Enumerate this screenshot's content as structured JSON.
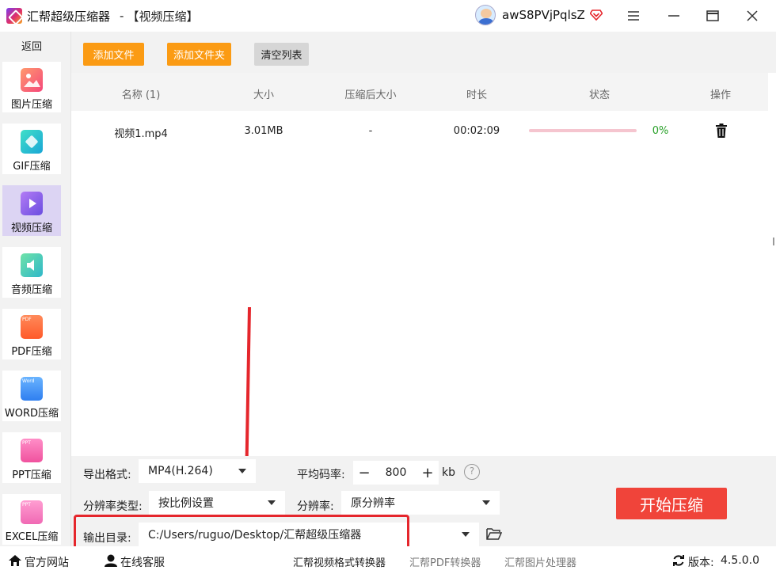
{
  "window": {
    "app_title": "汇帮超级压缩器",
    "separator": "-",
    "module_title": "【视频压缩】",
    "username": "awS8PVjPqlsZ",
    "brand_color": "#fb9b14",
    "accent_color": "#f0443a"
  },
  "sidebar": {
    "back_label": "返回",
    "items": [
      {
        "label": "图片压缩",
        "icon": "image-icon",
        "active": false
      },
      {
        "label": "GIF压缩",
        "icon": "gif-icon",
        "active": false
      },
      {
        "label": "视频压缩",
        "icon": "video-icon",
        "active": true
      },
      {
        "label": "音频压缩",
        "icon": "audio-icon",
        "active": false
      },
      {
        "label": "PDF压缩",
        "icon": "pdf-icon",
        "active": false
      },
      {
        "label": "WORD压缩",
        "icon": "word-icon",
        "active": false
      },
      {
        "label": "PPT压缩",
        "icon": "ppt-icon",
        "active": false
      },
      {
        "label": "EXCEL压缩",
        "icon": "excel-icon",
        "active": false
      }
    ],
    "pdf_badge": "PDF",
    "word_badge": "Word",
    "ppt_badge": "PPT",
    "excel_badge": "PPT"
  },
  "toolbar": {
    "add_file": "添加文件",
    "add_folder": "添加文件夹",
    "clear_list": "清空列表"
  },
  "table": {
    "columns": [
      "名称 (1)",
      "大小",
      "压缩后大小",
      "时长",
      "状态",
      "操作"
    ],
    "rows": [
      {
        "name": "视频1.mp4",
        "size": "3.01MB",
        "compressed": "-",
        "duration": "00:02:09",
        "progress": 0,
        "percent": "0%"
      }
    ]
  },
  "settings": {
    "format_label": "导出格式:",
    "format_value": "MP4(H.264)",
    "bitrate_label": "平均码率:",
    "bitrate_minus": "−",
    "bitrate_value": "800",
    "bitrate_plus": "+",
    "bitrate_unit": "kb",
    "help": "?",
    "res_type_label": "分辨率类型:",
    "res_type_value": "按比例设置",
    "res_label": "分辨率:",
    "res_value": "原分辨率",
    "output_label": "输出目录:",
    "output_value": "C:/Users/ruguo/Desktop/汇帮超级压缩器",
    "start_button": "开始压缩"
  },
  "footer": {
    "website": "官方网站",
    "support": "在线客服",
    "link1": "汇帮视频格式转换器",
    "link2": "汇帮PDF转换器",
    "link3": "汇帮图片处理器",
    "version_label": "版本:",
    "version": "4.5.0.0"
  }
}
